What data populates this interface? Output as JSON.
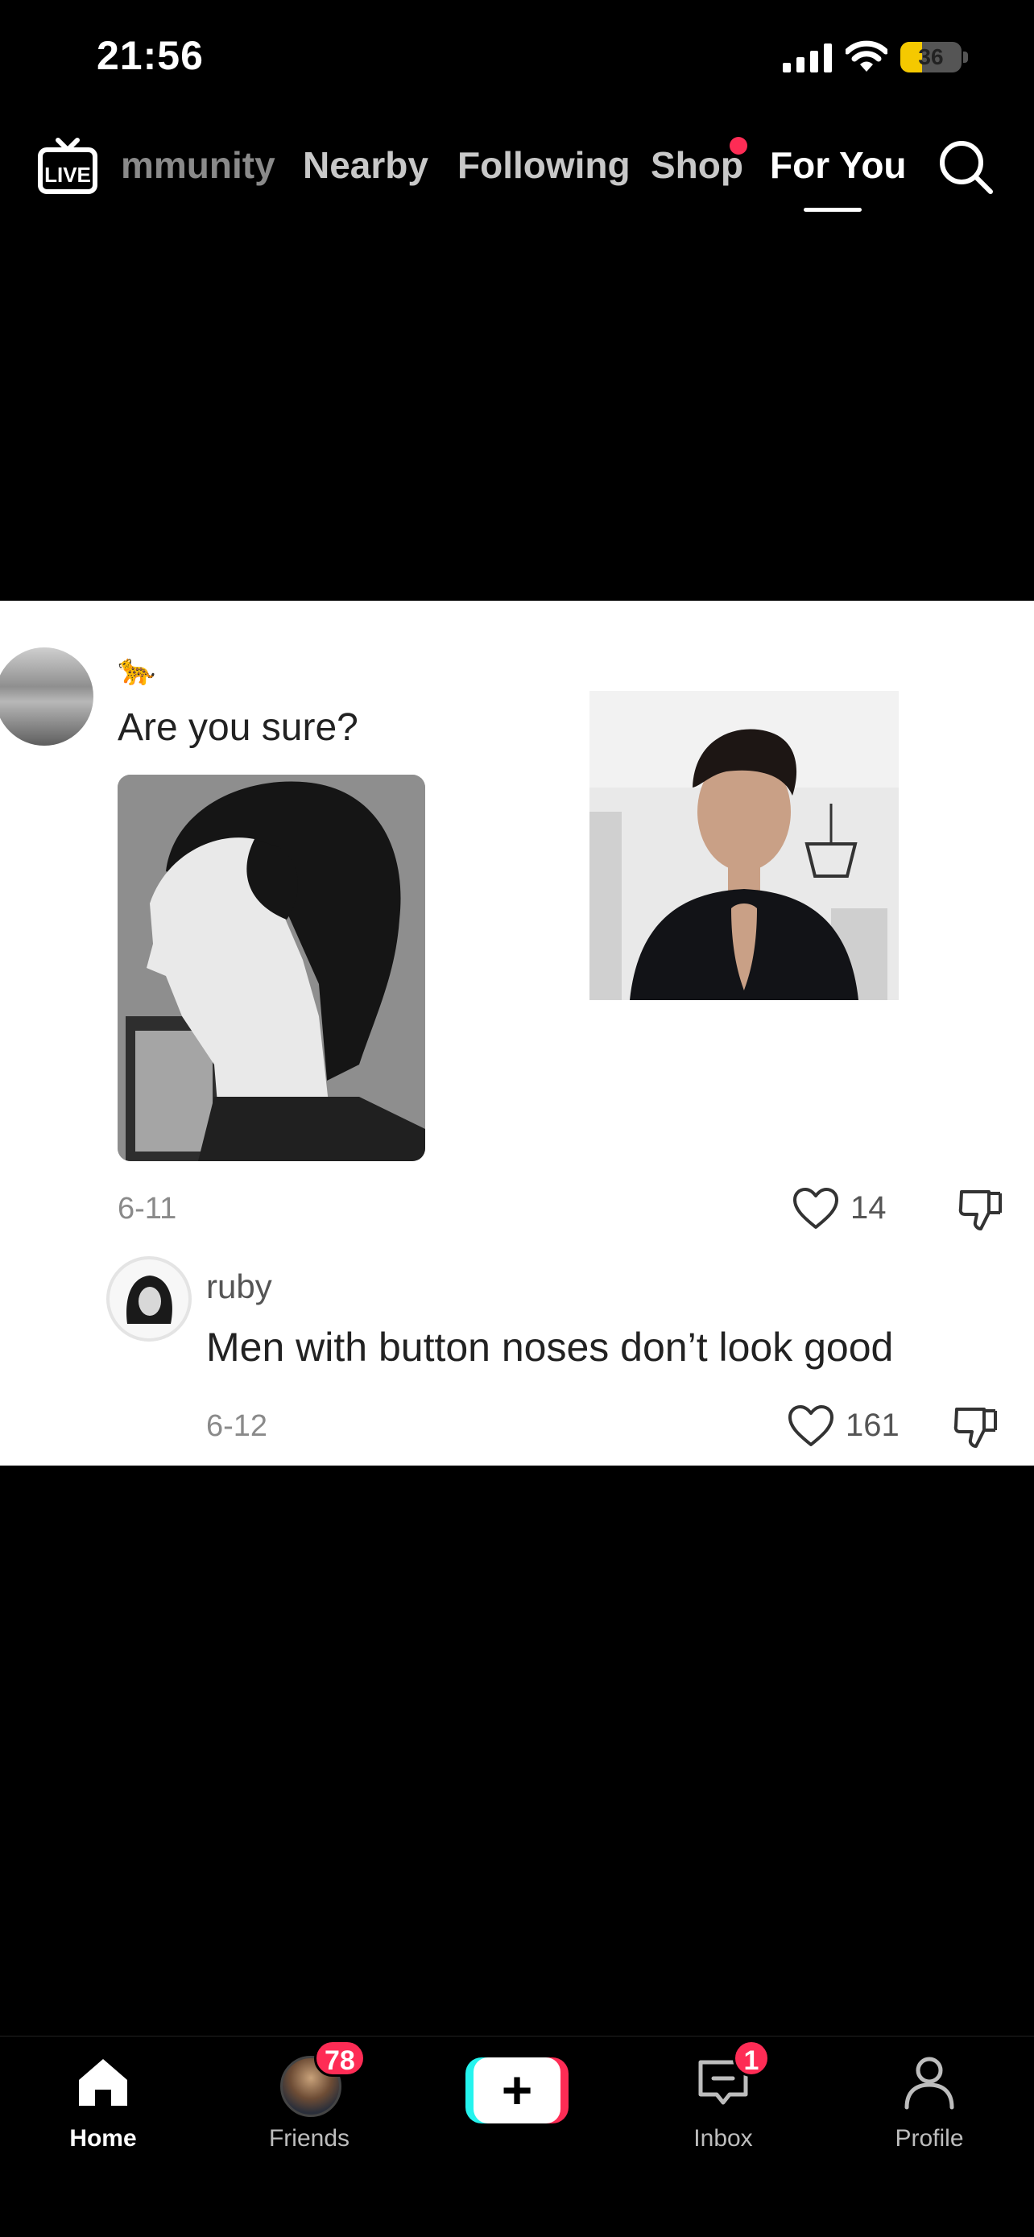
{
  "status_bar": {
    "time": "21:56",
    "battery_level": "36",
    "battery_fraction": 0.36,
    "icons": [
      "signal-icon",
      "wifi-icon",
      "battery-icon"
    ]
  },
  "top_nav": {
    "tabs": [
      {
        "label": "mmunity",
        "state": "partially-scrolled"
      },
      {
        "label": "Nearby"
      },
      {
        "label": "Following"
      },
      {
        "label": "Shop",
        "has_dot": true
      },
      {
        "label": "For You",
        "active": true
      }
    ],
    "live_label": "LIVE",
    "icons": [
      "live-tv-icon",
      "search-icon"
    ]
  },
  "comment": {
    "username": "🐆",
    "text": "Are you sure?",
    "date": "6-11",
    "likes": "14",
    "icons": [
      "heart-icon",
      "dislike-icon"
    ]
  },
  "reply": {
    "username": "ruby",
    "text": "Men with button noses don’t look good",
    "date": "6-12",
    "likes": "161"
  },
  "bottom_tabs": [
    {
      "label": "Home",
      "icon": "home-icon",
      "active": true
    },
    {
      "label": "Friends",
      "icon": "avatar",
      "badge": "78"
    },
    {
      "label": "",
      "icon": "create-icon"
    },
    {
      "label": "Inbox",
      "icon": "inbox-icon",
      "badge": "1"
    },
    {
      "label": "Profile",
      "icon": "profile-icon"
    }
  ],
  "colors": {
    "background": "#000000",
    "accent_red": "#fe2c55",
    "accent_cyan": "#25f4ee",
    "battery": "#f5c900"
  }
}
